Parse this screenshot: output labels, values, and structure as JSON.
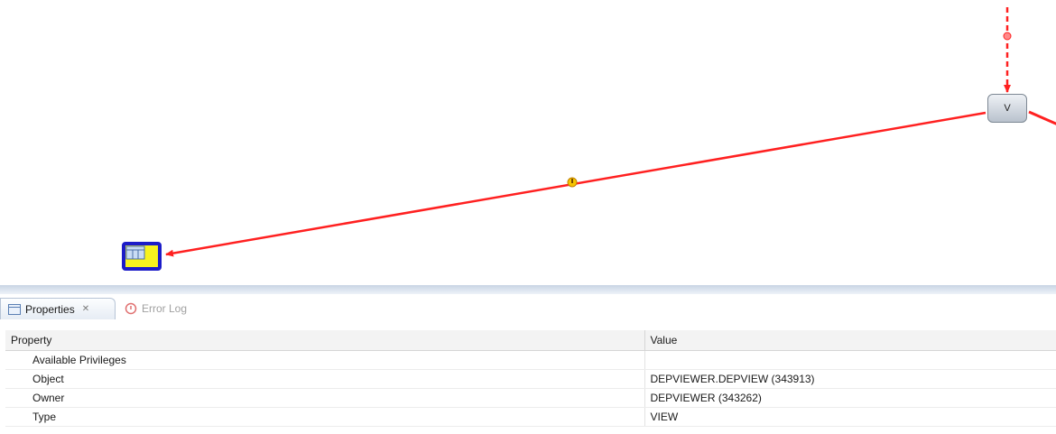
{
  "diagram": {
    "view_node_label": "V",
    "colors": {
      "edge": "#ff2020",
      "warning": "#e8a000",
      "table_node_fill": "#f7f21e",
      "table_node_border": "#1c1cc8"
    }
  },
  "properties_panel": {
    "tabs": [
      {
        "label": "Properties",
        "active": true
      },
      {
        "label": "Error Log",
        "active": false
      }
    ],
    "columns": [
      "Property",
      "Value"
    ],
    "rows": [
      {
        "property": "Available Privileges",
        "value": ""
      },
      {
        "property": "Object",
        "value": "DEPVIEWER.DEPVIEW (343913)"
      },
      {
        "property": "Owner",
        "value": "DEPVIEWER (343262)"
      },
      {
        "property": "Type",
        "value": "VIEW"
      }
    ]
  }
}
